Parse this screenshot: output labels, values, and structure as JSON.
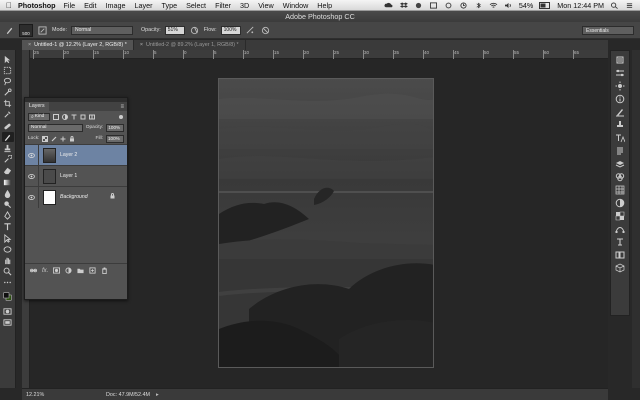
{
  "menubar": {
    "app_name": "Photoshop",
    "items": [
      "File",
      "Edit",
      "Image",
      "Layer",
      "Type",
      "Select",
      "Filter",
      "3D",
      "View",
      "Window",
      "Help"
    ],
    "battery": "54%",
    "clock": "Mon 12:44 PM"
  },
  "window": {
    "title": "Adobe Photoshop CC"
  },
  "options": {
    "brush_size": "500",
    "mode_label": "Mode:",
    "mode_value": "Normal",
    "opacity_label": "Opacity:",
    "opacity_value": "51%",
    "flow_label": "Flow:",
    "flow_value": "100%",
    "workspace": "Essentials"
  },
  "tabs": [
    {
      "label": "Untitled-1 @ 12.2% (Layer 2, RGB/8) *",
      "active": true
    },
    {
      "label": "Untitled-2 @ 89.2% (Layer 1, RGB/8) *",
      "active": false
    }
  ],
  "ruler": {
    "ticks": [
      "25",
      "20",
      "15",
      "10",
      "5",
      "0",
      "5",
      "10",
      "15",
      "20",
      "25",
      "30",
      "35",
      "40",
      "45",
      "50",
      "55",
      "60",
      "65"
    ]
  },
  "layers_panel": {
    "title": "Layers",
    "kind_label": "Kind",
    "blend_mode": "Normal",
    "opacity_label": "Opacity:",
    "opacity_value": "100%",
    "lock_label": "Lock:",
    "fill_label": "Fill:",
    "fill_value": "100%",
    "layers": [
      {
        "name": "Layer 2",
        "selected": true
      },
      {
        "name": "Layer 1",
        "selected": false
      },
      {
        "name": "Background",
        "selected": false
      }
    ]
  },
  "status": {
    "zoom": "12.21%",
    "doc_info": "Doc: 47.9M/52.4M"
  },
  "colors": {
    "accent_selected_layer": "#6d83a3",
    "panel_bg": "#535353",
    "workspace_bg": "#262626"
  }
}
